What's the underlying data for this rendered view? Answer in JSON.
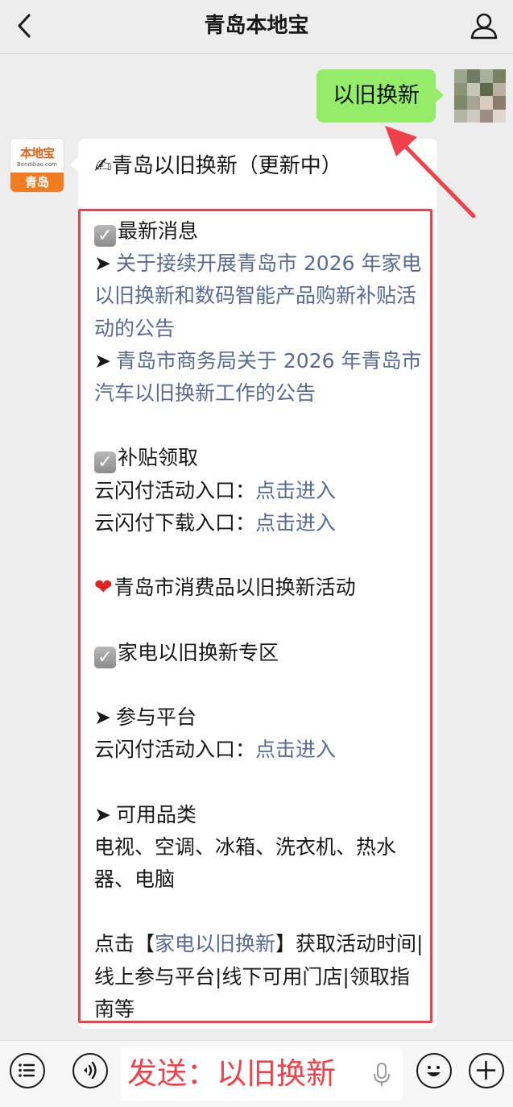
{
  "header": {
    "title": "青岛本地宝",
    "back_icon": "chevron-left-icon",
    "profile_icon": "person-icon"
  },
  "outgoing": {
    "text": "以旧换新"
  },
  "bot": {
    "avatar_brand": "本地宝",
    "avatar_domain": "Bendibao.com",
    "avatar_city": "青岛"
  },
  "message": {
    "heading": "✍青岛以旧换新（更新中）",
    "latest_title": "最新消息",
    "latest_items": [
      "关于接续开展青岛市 2026 年家电以旧换新和数码智能产品购新补贴活动的公告",
      "青岛市商务局关于 2026 年青岛市汽车以旧换新工作的公告"
    ],
    "subsidy_title": "补贴领取",
    "subsidy_rows": [
      {
        "label": "云闪付活动入口：",
        "link": "点击进入"
      },
      {
        "label": "云闪付下载入口：",
        "link": "点击进入"
      }
    ],
    "campaign_title": "青岛市消费品以旧换新活动",
    "appliance_title": "家电以旧换新专区",
    "platform_title": "参与平台",
    "platform_row": {
      "label": "云闪付活动入口：",
      "link": "点击进入"
    },
    "category_title": "可用品类",
    "category_text": "电视、空调、冰箱、洗衣机、热水器、电脑",
    "footer_prefix": "点击【",
    "footer_link": "家电以旧换新",
    "footer_suffix": "】获取活动时间|线上参与平台|线下可用门店|领取指南等"
  },
  "input_bar": {
    "text": "发送：以旧换新",
    "icons": [
      "menu-icon",
      "voice-icon",
      "mic-icon",
      "emoji-icon",
      "plus-icon"
    ]
  },
  "colors": {
    "bg": "#ededed",
    "bubble_out": "#95ec69",
    "link": "#576b95",
    "highlight": "#f0414a"
  }
}
